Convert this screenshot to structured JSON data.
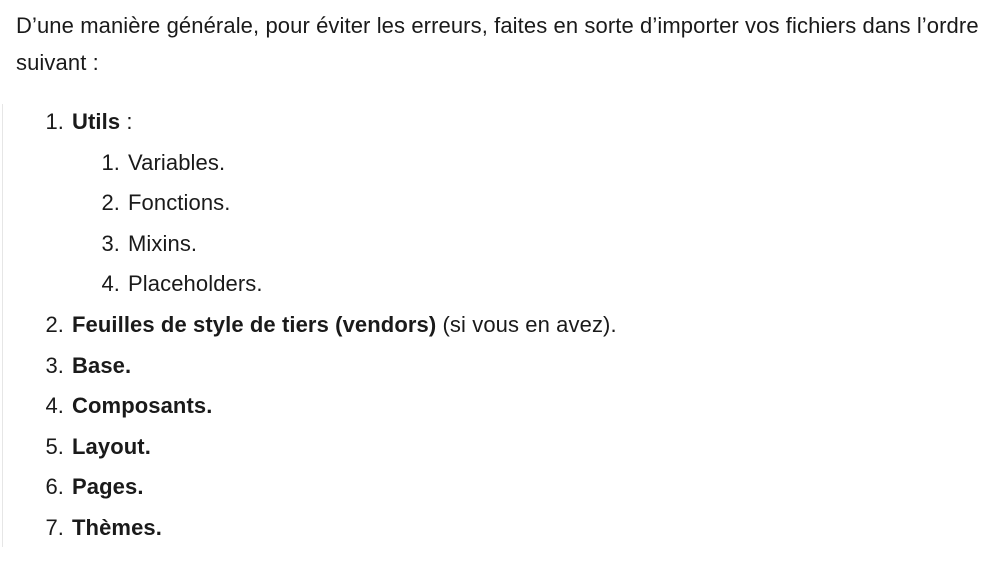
{
  "intro": {
    "text": "D’une manière générale, pour éviter les erreurs, faites en sorte d’importer vos fichiers dans l’ordre suivant :"
  },
  "list": {
    "items": [
      {
        "number": "1.",
        "bold": "Utils",
        "suffix": " :",
        "subitems": [
          {
            "number": "1.",
            "text": "Variables."
          },
          {
            "number": "2.",
            "text": "Fonctions."
          },
          {
            "number": "3.",
            "text": "Mixins."
          },
          {
            "number": "4.",
            "text": "Placeholders."
          }
        ]
      },
      {
        "number": "2.",
        "bold": "Feuilles de style de tiers (vendors)",
        "suffix": " (si vous en avez)."
      },
      {
        "number": "3.",
        "bold": "Base.",
        "suffix": ""
      },
      {
        "number": "4.",
        "bold": "Composants.",
        "suffix": ""
      },
      {
        "number": "5.",
        "bold": "Layout.",
        "suffix": ""
      },
      {
        "number": "6.",
        "bold": "Pages.",
        "suffix": ""
      },
      {
        "number": "7.",
        "bold": "Thèmes.",
        "suffix": ""
      }
    ]
  }
}
